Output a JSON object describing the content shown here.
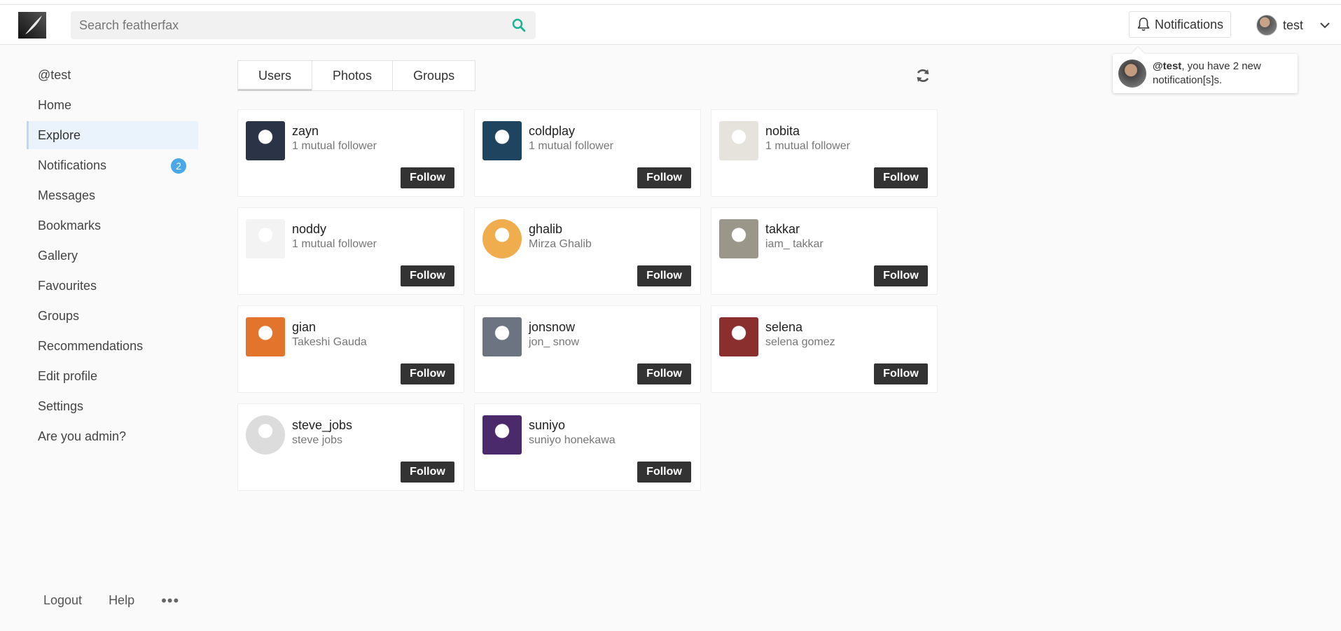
{
  "header": {
    "search_placeholder": "Search featherfax",
    "notifications_label": "Notifications",
    "username": "test"
  },
  "toast": {
    "handle": "@test",
    "message": ", you have 2 new notification[s]s."
  },
  "sidebar": {
    "items": [
      {
        "label": "@test",
        "active": false
      },
      {
        "label": "Home",
        "active": false
      },
      {
        "label": "Explore",
        "active": true
      },
      {
        "label": "Notifications",
        "active": false,
        "badge": "2"
      },
      {
        "label": "Messages",
        "active": false
      },
      {
        "label": "Bookmarks",
        "active": false
      },
      {
        "label": "Gallery",
        "active": false
      },
      {
        "label": "Favourites",
        "active": false
      },
      {
        "label": "Groups",
        "active": false
      },
      {
        "label": "Recommendations",
        "active": false
      },
      {
        "label": "Edit profile",
        "active": false
      },
      {
        "label": "Settings",
        "active": false
      },
      {
        "label": "Are you admin?",
        "active": false
      }
    ],
    "footer": {
      "logout": "Logout",
      "help": "Help",
      "more": "•••"
    }
  },
  "tabs": [
    {
      "label": "Users",
      "active": true
    },
    {
      "label": "Photos",
      "active": false
    },
    {
      "label": "Groups",
      "active": false
    }
  ],
  "follow_label": "Follow",
  "users": [
    {
      "name": "zayn",
      "sub": "1 mutual follower",
      "color": "#2b3446"
    },
    {
      "name": "coldplay",
      "sub": "1 mutual follower",
      "color": "#1f4460"
    },
    {
      "name": "nobita",
      "sub": "1 mutual follower",
      "color": "#e6e3dc"
    },
    {
      "name": "noddy",
      "sub": "1 mutual follower",
      "color": "#f3f3f3"
    },
    {
      "name": "ghalib",
      "sub": "Mirza Ghalib",
      "color": "#f0ad4e"
    },
    {
      "name": "takkar",
      "sub": "iam_ takkar",
      "color": "#9a968a"
    },
    {
      "name": "gian",
      "sub": "Takeshi Gauda",
      "color": "#e2742c"
    },
    {
      "name": "jonsnow",
      "sub": "jon_ snow",
      "color": "#6b7480"
    },
    {
      "name": "selena",
      "sub": "selena gomez",
      "color": "#8a2e2e"
    },
    {
      "name": "steve_jobs",
      "sub": "steve jobs",
      "color": "#dcdcdc"
    },
    {
      "name": "suniyo",
      "sub": "suniyo honekawa",
      "color": "#4a2a6a"
    }
  ]
}
